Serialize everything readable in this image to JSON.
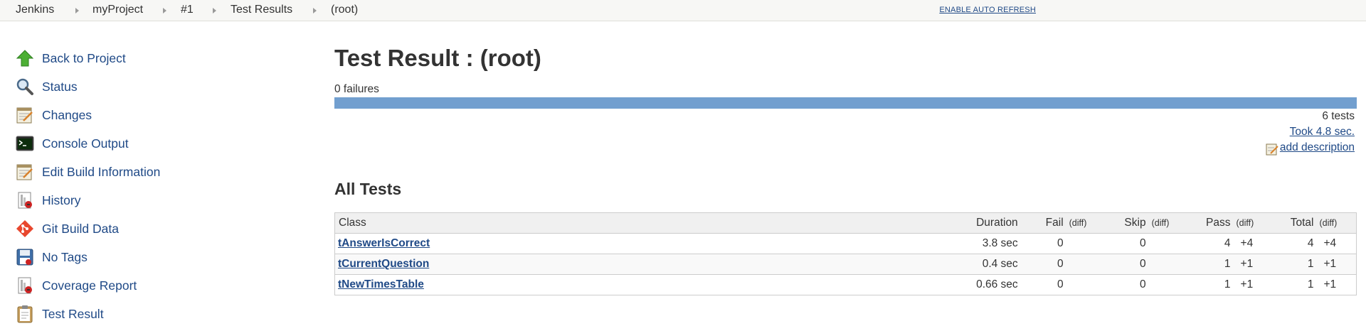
{
  "breadcrumb": {
    "items": [
      "Jenkins",
      "myProject",
      "#1",
      "Test Results",
      "(root)"
    ],
    "auto_refresh": "ENABLE AUTO REFRESH"
  },
  "sidebar": {
    "items": [
      {
        "label": "Back to Project",
        "icon": "up-arrow-icon"
      },
      {
        "label": "Status",
        "icon": "magnifier-icon"
      },
      {
        "label": "Changes",
        "icon": "notepad-icon"
      },
      {
        "label": "Console Output",
        "icon": "terminal-icon"
      },
      {
        "label": "Edit Build Information",
        "icon": "notepad-icon"
      },
      {
        "label": "History",
        "icon": "clipboard-chart-icon"
      },
      {
        "label": "Git Build Data",
        "icon": "git-icon"
      },
      {
        "label": "No Tags",
        "icon": "floppy-disk-icon"
      },
      {
        "label": "Coverage Report",
        "icon": "clipboard-chart-icon"
      },
      {
        "label": "Test Result",
        "icon": "clipboard-icon"
      }
    ]
  },
  "main": {
    "title": "Test Result : (root)",
    "failures": "0 failures",
    "pass_fraction": 1.0,
    "tests_count": "6 tests",
    "took": "Took 4.8 sec.",
    "add_description": "add description",
    "section_title": "All Tests"
  },
  "table": {
    "headers": {
      "class": "Class",
      "duration": "Duration",
      "fail": "Fail",
      "skip": "Skip",
      "pass": "Pass",
      "total": "Total",
      "diff": "(diff)"
    },
    "rows": [
      {
        "class": "tAnswerIsCorrect",
        "duration": "3.8 sec",
        "fail": "0",
        "fail_diff": "",
        "skip": "0",
        "skip_diff": "",
        "pass": "4",
        "pass_diff": "+4",
        "total": "4",
        "total_diff": "+4"
      },
      {
        "class": "tCurrentQuestion",
        "duration": "0.4 sec",
        "fail": "0",
        "fail_diff": "",
        "skip": "0",
        "skip_diff": "",
        "pass": "1",
        "pass_diff": "+1",
        "total": "1",
        "total_diff": "+1"
      },
      {
        "class": "tNewTimesTable",
        "duration": "0.66 sec",
        "fail": "0",
        "fail_diff": "",
        "skip": "0",
        "skip_diff": "",
        "pass": "1",
        "pass_diff": "+1",
        "total": "1",
        "total_diff": "+1"
      }
    ]
  },
  "colors": {
    "link": "#204a87",
    "pass_bar": "#729fcf",
    "header_bg": "#f0f0f0"
  }
}
